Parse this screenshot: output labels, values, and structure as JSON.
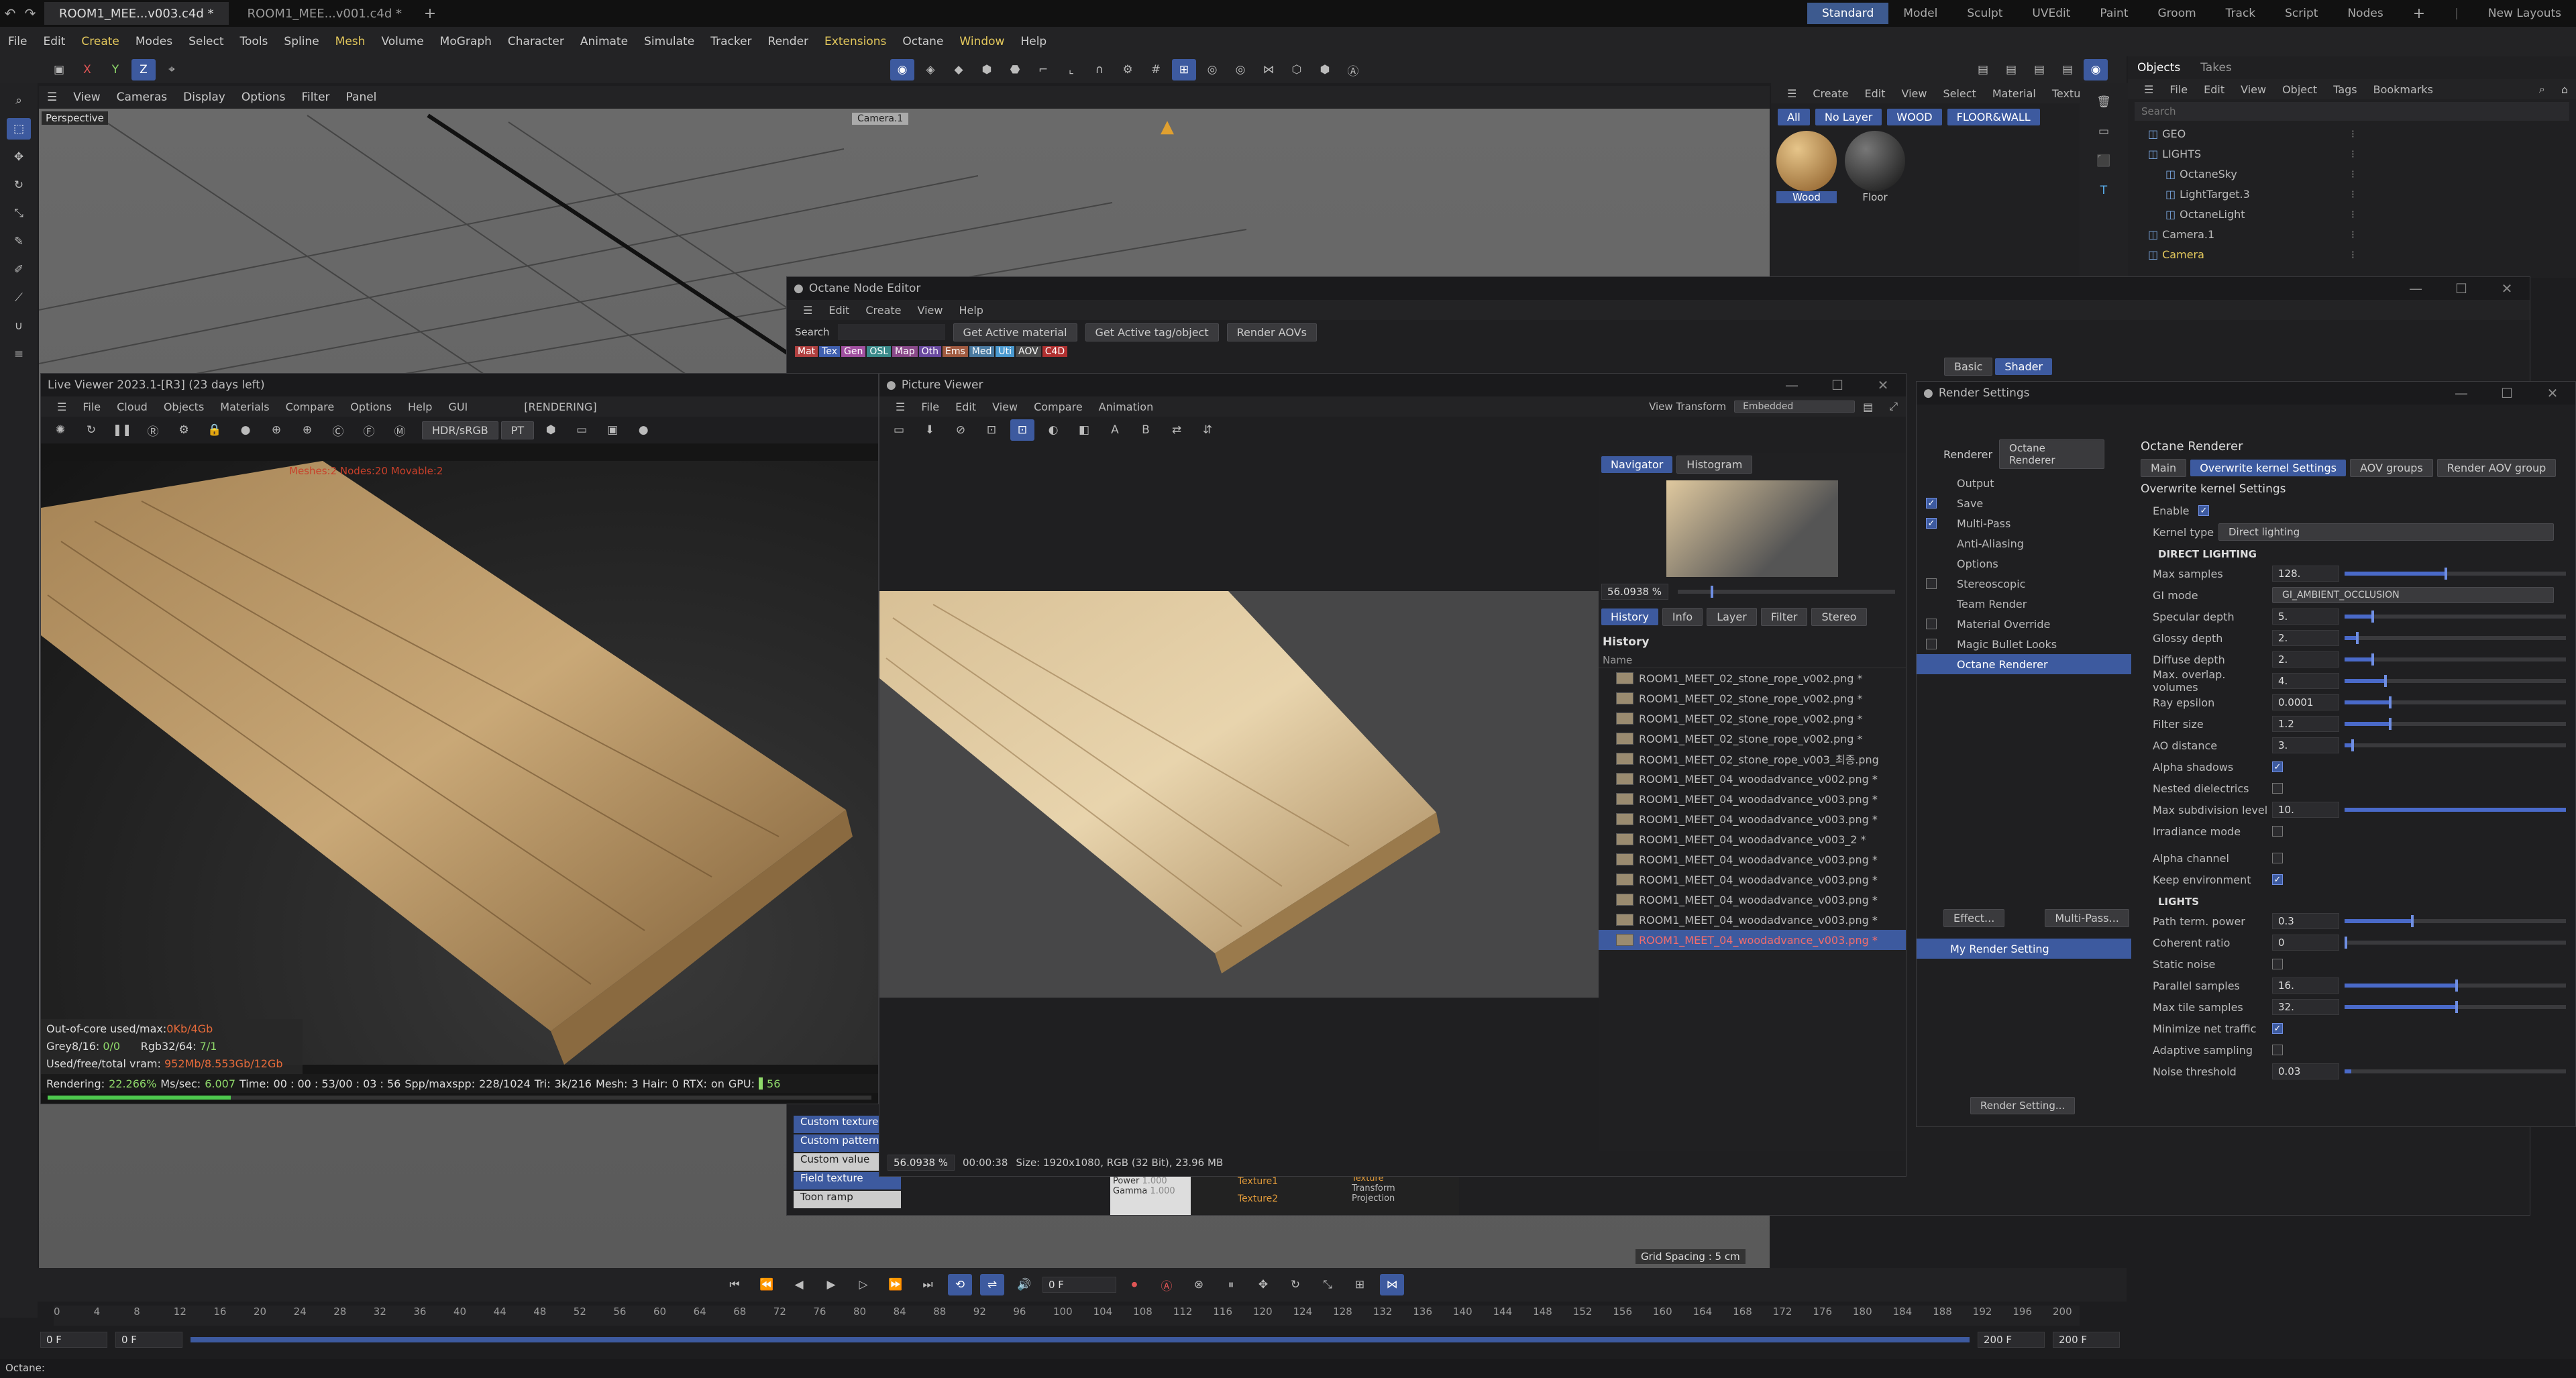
{
  "tabs": [
    {
      "label": "ROOM1_MEE...v003.c4d *",
      "active": true
    },
    {
      "label": "ROOM1_MEE...v001.c4d *",
      "active": false
    }
  ],
  "layouts": [
    "Standard",
    "Model",
    "Sculpt",
    "UVEdit",
    "Paint",
    "Groom",
    "Track",
    "Script",
    "Nodes"
  ],
  "new_layouts": "New Layouts",
  "menu": [
    "File",
    "Edit",
    "Create",
    "Modes",
    "Select",
    "Tools",
    "Spline",
    "Mesh",
    "Volume",
    "MoGraph",
    "Character",
    "Animate",
    "Simulate",
    "Tracker",
    "Render",
    "Extensions",
    "Octane",
    "Window",
    "Help"
  ],
  "viewport": {
    "menu": [
      "View",
      "Cameras",
      "Display",
      "Options",
      "Filter",
      "Panel"
    ],
    "label": "Perspective",
    "camera": "Camera.1",
    "grid_spacing": "Grid Spacing : 5 cm"
  },
  "axis": {
    "x": "X",
    "y": "Y",
    "z": "Z"
  },
  "materials": {
    "menu": [
      "Create",
      "Edit",
      "View",
      "Select",
      "Material",
      "Texture"
    ],
    "filters": [
      "All",
      "No Layer",
      "WOOD",
      "FLOOR&WALL"
    ],
    "items": [
      "Wood",
      "Floor"
    ]
  },
  "objects": {
    "tabs": [
      "Objects",
      "Takes"
    ],
    "menu": [
      "File",
      "Edit",
      "View",
      "Object",
      "Tags",
      "Bookmarks"
    ],
    "search_placeholder": "Search",
    "items": [
      {
        "name": "GEO",
        "indent": 0
      },
      {
        "name": "LIGHTS",
        "indent": 0
      },
      {
        "name": "OctaneSky",
        "indent": 1
      },
      {
        "name": "LightTarget.3",
        "indent": 1
      },
      {
        "name": "OctaneLight",
        "indent": 1
      },
      {
        "name": "Camera.1",
        "indent": 0
      },
      {
        "name": "Camera",
        "indent": 0
      }
    ]
  },
  "node_editor": {
    "title": "Octane Node Editor",
    "menu": [
      "Edit",
      "Create",
      "View",
      "Help"
    ],
    "search_label": "Search",
    "buttons": [
      "Get Active material",
      "Get Active tag/object",
      "Render AOVs"
    ],
    "categories": [
      "Mat",
      "Tex",
      "Gen",
      "OSL",
      "Map",
      "Oth",
      "Ems",
      "Med",
      "Uti",
      "AOV",
      "C4D"
    ],
    "shader_tabs": [
      "Basic",
      "Shader"
    ],
    "side_items": [
      "Custom texture",
      "Custom pattern",
      "Custom value",
      "Field texture",
      "Toon ramp"
    ],
    "node_fields": [
      "Power",
      "Gamma"
    ],
    "node_values": [
      "1.000",
      "1.000"
    ],
    "ports": [
      "Texture1",
      "Texture2"
    ],
    "transform_items": [
      "Texture",
      "Transform",
      "Projection"
    ]
  },
  "live_viewer": {
    "title": "Live Viewer 2023.1-[R3] (23 days left)",
    "menu": [
      "File",
      "Cloud",
      "Objects",
      "Materials",
      "Compare",
      "Options",
      "Help",
      "GUI"
    ],
    "status": "[RENDERING]",
    "color_space": "HDR/sRGB",
    "kernel": "PT",
    "overlay": "Meshes:2 Nodes:20 Movable:2",
    "stats": {
      "out_of_core": "Out-of-core used/max:",
      "out_of_core_val": "0Kb/4Gb",
      "grey": "Grey8/16:",
      "grey_val": "0/0",
      "rgb": "Rgb32/64:",
      "rgb_val": "7/1",
      "vram": "Used/free/total vram:",
      "vram_val": "952Mb/8.553Gb/12Gb"
    },
    "render_line": {
      "rendering": "Rendering:",
      "rendering_val": "22.266%",
      "ms": "Ms/sec:",
      "ms_val": "6.007",
      "time": "Time:",
      "time_val": "00 : 00 : 53/00 : 03 : 56",
      "spp": "Spp/maxspp:",
      "spp_val": "228/1024",
      "tri": "Tri:",
      "tri_val": "3k/216",
      "mesh": "Mesh:",
      "mesh_val": "3",
      "hair": "Hair:",
      "hair_val": "0",
      "rtx": "RTX:",
      "rtx_val": "on",
      "gpu": "GPU:",
      "gpu_val": "56"
    },
    "progress": 0.2227
  },
  "picture_viewer": {
    "title": "Picture Viewer",
    "menu": [
      "File",
      "Edit",
      "View",
      "Compare",
      "Animation"
    ],
    "view_transform": "View Transform",
    "view_transform_val": "Embedded",
    "tabs_top": [
      "Navigator",
      "Histogram"
    ],
    "zoom": "56.0938 %",
    "tabs_mid": [
      "History",
      "Info",
      "Layer",
      "Filter",
      "Stereo"
    ],
    "history_title": "History",
    "name_col": "Name",
    "history": [
      "ROOM1_MEET_02_stone_rope_v002.png *",
      "ROOM1_MEET_02_stone_rope_v002.png *",
      "ROOM1_MEET_02_stone_rope_v002.png *",
      "ROOM1_MEET_02_stone_rope_v002.png *",
      "ROOM1_MEET_02_stone_rope_v003_최종.png",
      "ROOM1_MEET_04_woodadvance_v002.png *",
      "ROOM1_MEET_04_woodadvance_v003.png *",
      "ROOM1_MEET_04_woodadvance_v003.png *",
      "ROOM1_MEET_04_woodadvance_v003_2 *",
      "ROOM1_MEET_04_woodadvance_v003.png *",
      "ROOM1_MEET_04_woodadvance_v003.png *",
      "ROOM1_MEET_04_woodadvance_v003.png *",
      "ROOM1_MEET_04_woodadvance_v003.png *",
      "ROOM1_MEET_04_woodadvance_v003.png *"
    ],
    "footer_zoom": "56.0938 %",
    "footer_time": "00:00:38",
    "footer_size": "Size: 1920x1080, RGB (32 Bit), 23.96 MB"
  },
  "render_settings": {
    "title": "Render Settings",
    "renderer_label": "Renderer",
    "renderer": "Octane Renderer",
    "list": [
      {
        "label": "Output",
        "cb": null
      },
      {
        "label": "Save",
        "cb": true
      },
      {
        "label": "Multi-Pass",
        "cb": true
      },
      {
        "label": "Anti-Aliasing",
        "cb": null
      },
      {
        "label": "Options",
        "cb": null
      },
      {
        "label": "Stereoscopic",
        "cb": false
      },
      {
        "label": "Team Render",
        "cb": null
      },
      {
        "label": "Material Override",
        "cb": false
      },
      {
        "label": "Magic Bullet Looks",
        "cb": false
      },
      {
        "label": "Octane Renderer",
        "cb": null,
        "sel": true
      }
    ],
    "effect": "Effect...",
    "multipass": "Multi-Pass...",
    "setting": "My Render Setting",
    "setting_btn": "Render Setting...",
    "heading": "Octane Renderer",
    "tabs": [
      "Main",
      "Overwrite kernel Settings",
      "AOV groups",
      "Render AOV group"
    ],
    "section": "Overwrite kernel Settings",
    "enable": "Enable",
    "kernel_type": "Kernel type",
    "kernel_type_val": "Direct lighting",
    "group": "DIRECT LIGHTING",
    "params": [
      {
        "label": "Max samples",
        "value": "128.",
        "fill": 0.45
      },
      {
        "label": "GI mode",
        "value": "GI_AMBIENT_OCCLUSION",
        "dropdown": true
      },
      {
        "label": "Specular depth",
        "value": "5.",
        "fill": 0.12
      },
      {
        "label": "Glossy depth",
        "value": "2.",
        "fill": 0.05
      },
      {
        "label": "Diffuse depth",
        "value": "2.",
        "fill": 0.12
      },
      {
        "label": "Max. overlap. volumes",
        "value": "4.",
        "fill": 0.18
      },
      {
        "label": "Ray epsilon",
        "value": "0.0001",
        "fill": 0.2
      },
      {
        "label": "Filter size",
        "value": "1.2",
        "fill": 0.2
      },
      {
        "label": "AO distance",
        "value": "3.",
        "fill": 0.03
      }
    ],
    "checks1": [
      {
        "label": "Alpha shadows",
        "on": true
      },
      {
        "label": "Nested dielectrics",
        "on": false
      }
    ],
    "subdiv": {
      "label": "Max subdivision level",
      "value": "10.",
      "fill": 1.0
    },
    "irr": {
      "label": "Irradiance mode",
      "on": false
    },
    "checks2": [
      {
        "label": "Alpha channel",
        "on": false
      },
      {
        "label": "Keep environment",
        "on": true
      }
    ],
    "lights": "LIGHTS",
    "params2": [
      {
        "label": "Path term. power",
        "value": "0.3",
        "fill": 0.3
      },
      {
        "label": "Coherent ratio",
        "value": "0",
        "fill": 0.0
      }
    ],
    "static": {
      "label": "Static noise",
      "on": false
    },
    "params3": [
      {
        "label": "Parallel samples",
        "value": "16.",
        "fill": 0.5
      },
      {
        "label": "Max tile samples",
        "value": "32.",
        "fill": 0.5
      }
    ],
    "minnet": {
      "label": "Minimize net traffic",
      "on": true
    },
    "adaptive": {
      "label": "Adaptive sampling",
      "on": false
    },
    "noise": {
      "label": "Noise threshold",
      "value": "0.03",
      "fill": 0.03
    }
  },
  "timeline": {
    "ticks": [
      "0",
      "4",
      "8",
      "12",
      "16",
      "20",
      "24",
      "28",
      "32",
      "36",
      "40",
      "44",
      "48",
      "52",
      "56",
      "60",
      "64",
      "68",
      "72",
      "76",
      "80",
      "84",
      "88",
      "92",
      "96",
      "100",
      "104",
      "108",
      "112",
      "116",
      "120",
      "124",
      "128",
      "132",
      "136",
      "140",
      "144",
      "148",
      "152",
      "156",
      "160",
      "164",
      "168",
      "172",
      "176",
      "180",
      "184",
      "188",
      "192",
      "196",
      "200"
    ],
    "frame": "0 F",
    "start": "0 F",
    "start2": "0 F",
    "end": "200 F",
    "end2": "200 F"
  },
  "status_bar": "Octane:"
}
